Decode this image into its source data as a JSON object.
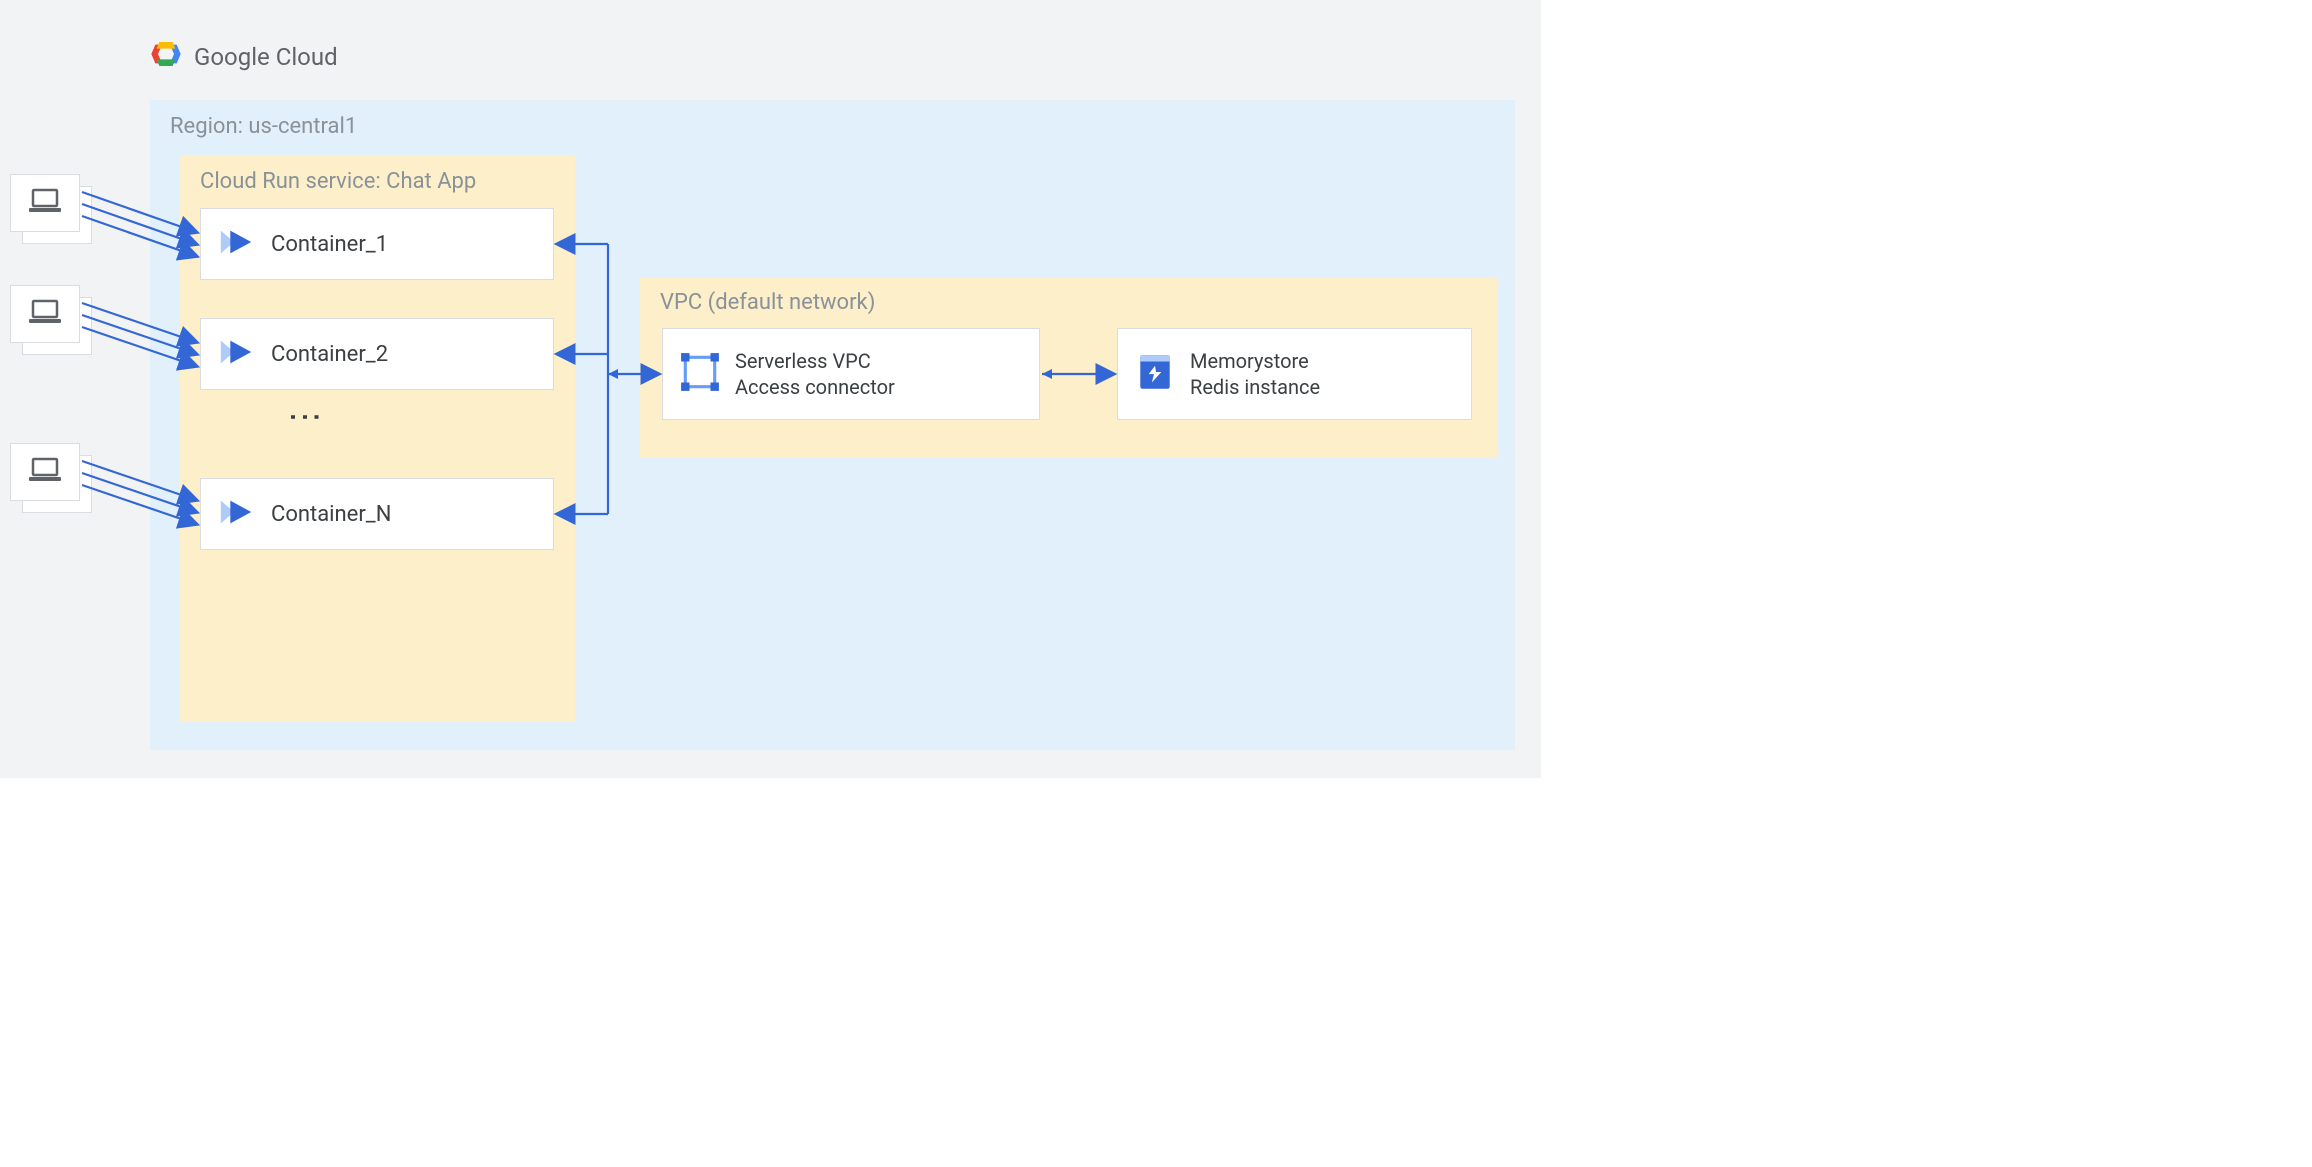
{
  "header": {
    "title": "Google Cloud"
  },
  "region": {
    "label": "Region: us-central1"
  },
  "cloudrun": {
    "label": "Cloud Run service: Chat App",
    "containers": {
      "0": {
        "label": "Container_1"
      },
      "1": {
        "label": "Container_2"
      },
      "2": {
        "label": "Container_N"
      }
    },
    "ellipsis": "⋮"
  },
  "vpc": {
    "label": "VPC (default network)",
    "connector": {
      "line1": "Serverless VPC",
      "line2": "Access connector"
    },
    "redis": {
      "line1": "Memorystore",
      "line2": "Redis instance"
    }
  },
  "icons": {
    "laptop": "laptop-icon",
    "cloudrun": "cloud-run-icon",
    "vpc": "vpc-icon",
    "redis": "memorystore-icon",
    "logo": "google-cloud-icon"
  }
}
